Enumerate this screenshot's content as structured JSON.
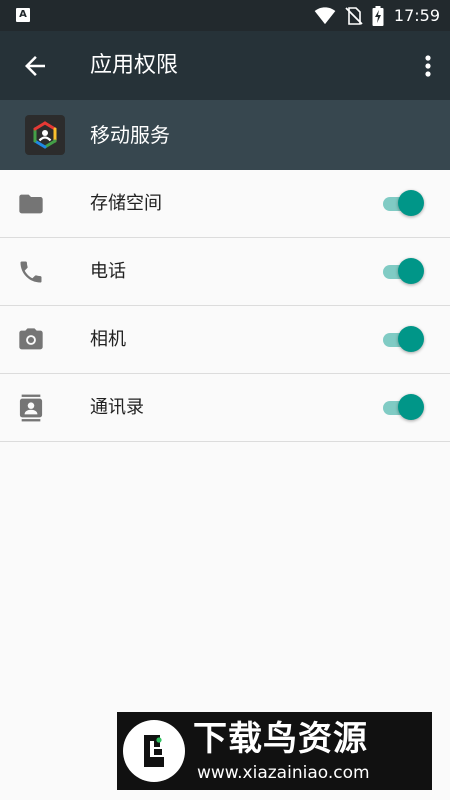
{
  "status_bar": {
    "app_icon_letter": "A",
    "time": "17:59",
    "icons": [
      "wifi-icon",
      "no-sim-icon",
      "battery-charging-icon"
    ]
  },
  "app_bar": {
    "title": "应用权限",
    "back_icon": "arrow-back-icon",
    "menu_icon": "more-vert-icon"
  },
  "app_header": {
    "name": "移动服务",
    "logo_icon": "hexagon-logo-icon"
  },
  "permissions": [
    {
      "label": "存储空间",
      "icon": "folder-icon",
      "enabled": true
    },
    {
      "label": "电话",
      "icon": "phone-icon",
      "enabled": true
    },
    {
      "label": "相机",
      "icon": "camera-icon",
      "enabled": true
    },
    {
      "label": "通讯录",
      "icon": "contacts-icon",
      "enabled": true
    }
  ],
  "watermark": {
    "title": "下载鸟资源",
    "url": "www.xiazainiao.com"
  },
  "colors": {
    "status_bar": "#22292d",
    "app_bar": "#263238",
    "app_header": "#37474f",
    "accent": "#009688",
    "switch_track": "#80cbc4",
    "background": "#fafafa"
  }
}
